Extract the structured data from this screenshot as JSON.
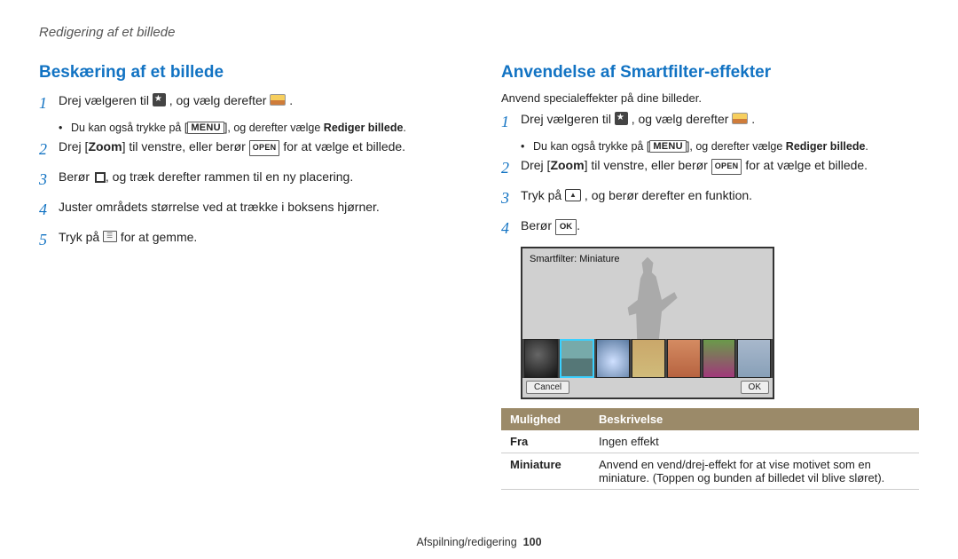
{
  "header": {
    "title": "Redigering af et billede"
  },
  "left": {
    "title": "Beskæring af et billede",
    "step1_prefix": "Drej vælgeren til ",
    "step1_suffix": ", og vælg derefter ",
    "step1_end": ".",
    "bullet1_prefix": "Du kan også trykke på [",
    "bullet1_menu": "MENU",
    "bullet1_mid": "], og derefter vælge ",
    "bullet1_bold": "Rediger billede",
    "bullet1_end": ".",
    "step2_prefix": "Drej [",
    "step2_bold": "Zoom",
    "step2_mid": "] til venstre, eller berør ",
    "step2_open": "OPEN",
    "step2_suffix": " for at vælge et billede.",
    "step3_prefix": "Berør ",
    "step3_suffix": ", og træk derefter rammen til en ny placering.",
    "step4": "Juster områdets størrelse ved at trække i boksens hjørner.",
    "step5_prefix": "Tryk på ",
    "step5_suffix": " for at gemme."
  },
  "right": {
    "title": "Anvendelse af Smartfilter-effekter",
    "intro": "Anvend specialeffekter på dine billeder.",
    "step1_prefix": "Drej vælgeren til ",
    "step1_suffix": ", og vælg derefter ",
    "step1_end": ".",
    "bullet1_prefix": "Du kan også trykke på [",
    "bullet1_menu": "MENU",
    "bullet1_mid": "], og derefter vælge ",
    "bullet1_bold": "Rediger billede",
    "bullet1_end": ".",
    "step2_prefix": "Drej [",
    "step2_bold": "Zoom",
    "step2_mid": "] til venstre, eller berør ",
    "step2_open": "OPEN",
    "step2_suffix": " for at vælge et billede.",
    "step3_prefix": "Tryk på ",
    "step3_suffix": " , og berør derefter en funktion.",
    "step4_prefix": "Berør ",
    "step4_ok": "OK",
    "step4_end": ".",
    "screenshot": {
      "label": "Smartfilter: Miniature",
      "cancel": "Cancel",
      "ok": "OK"
    },
    "table": {
      "head_opt": "Mulighed",
      "head_desc": "Beskrivelse",
      "rows": [
        {
          "opt": "Fra",
          "desc": "Ingen effekt"
        },
        {
          "opt": "Miniature",
          "desc": "Anvend en vend/drej-effekt for at vise motivet som en miniature. (Toppen og bunden af billedet vil blive sløret)."
        }
      ]
    }
  },
  "footer": {
    "section": "Afspilning/redigering",
    "page": "100"
  }
}
